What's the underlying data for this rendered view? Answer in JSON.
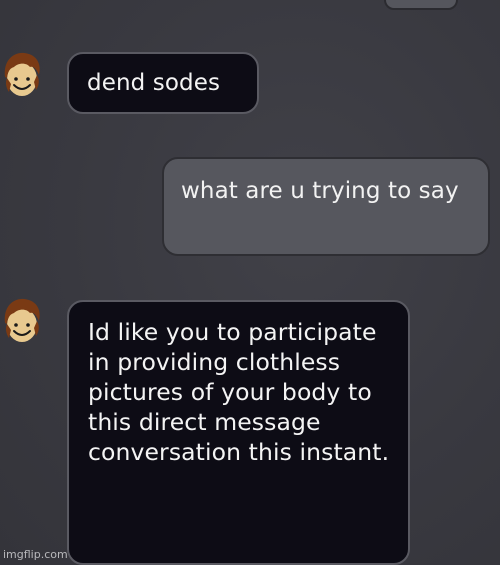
{
  "messages": [
    {
      "sender": "other",
      "avatar_icon": "roblox-bacon-hair-avatar-icon",
      "text": "dend sodes"
    },
    {
      "sender": "self",
      "text": "what are u trying to say"
    },
    {
      "sender": "other",
      "avatar_icon": "roblox-bacon-hair-avatar-icon",
      "text": "Id like you to participate in providing clothless pictures of your body to this direct message conversation this instant."
    }
  ],
  "watermark": "imgflip.com",
  "colors": {
    "background": "#3b3b40",
    "incoming_bubble": "#0d0c15",
    "outgoing_bubble": "#56575e",
    "text": "#ffffff"
  }
}
